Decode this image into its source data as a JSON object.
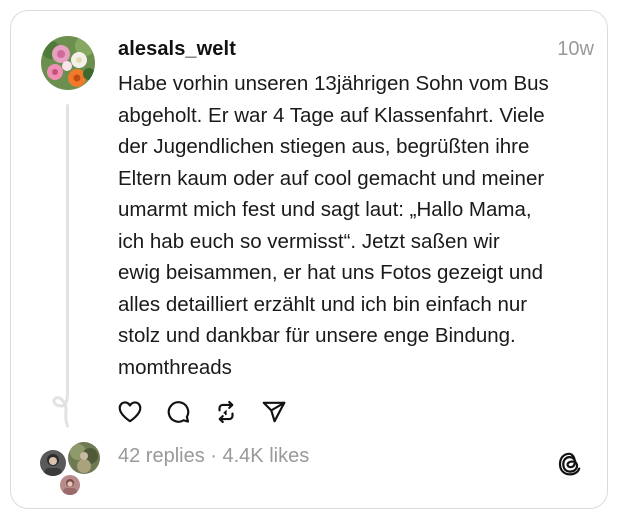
{
  "post": {
    "username": "alesals_welt",
    "time": "10w",
    "body_lines": [
      "Habe vorhin unseren 13jährigen Sohn vom Bus",
      "abgeholt. Er war 4 Tage auf Klassenfahrt. Viele",
      "der Jugendlichen stiegen aus, begrüßten ihre",
      "Eltern kaum oder auf cool gemacht und meiner",
      "umarmt mich fest und sagt laut: „Hallo Mama,",
      "ich hab euch so vermisst“. Jetzt saßen wir",
      "ewig beisammen, er hat uns Fotos gezeigt und",
      "alles detailliert erzählt und ich bin einfach nur",
      "stolz und dankbar für unsere enge Bindung.",
      "momthreads"
    ]
  },
  "stats": {
    "replies": "42 replies",
    "separator": " · ",
    "likes": "4.4K likes"
  },
  "icons": {
    "like": "heart-icon",
    "reply": "comment-icon",
    "repost": "repost-icon",
    "share": "send-icon",
    "brand": "threads-logo-icon"
  },
  "colors": {
    "text": "#1a1a1a",
    "muted": "#999999",
    "border": "#dcdcdc"
  }
}
